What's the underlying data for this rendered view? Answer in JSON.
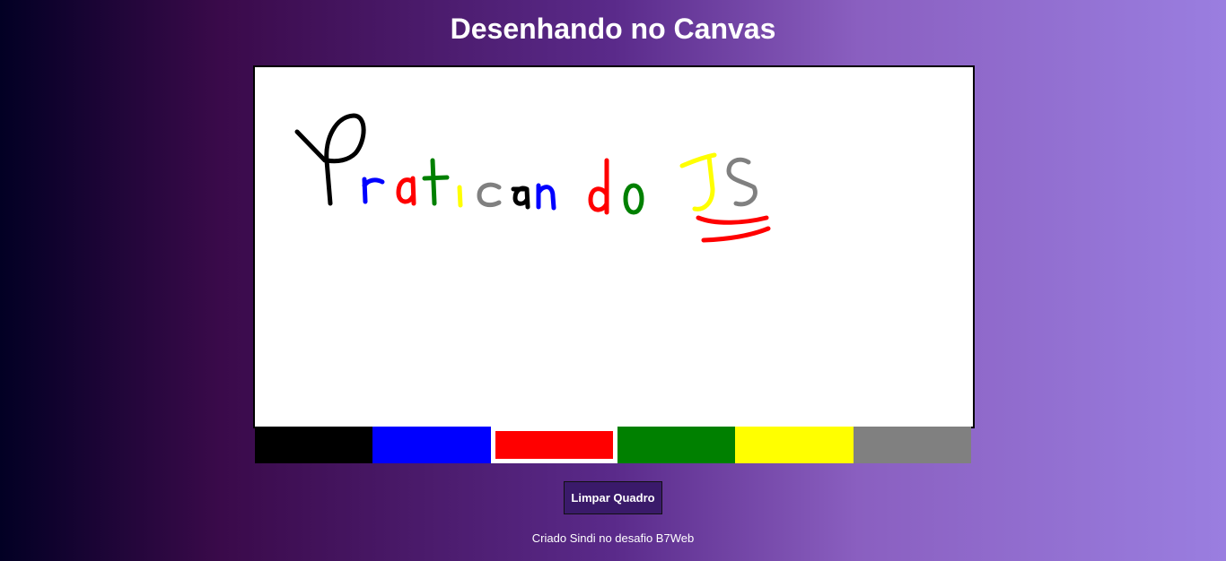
{
  "page": {
    "title": "Desenhando no Canvas"
  },
  "palette": {
    "colors": [
      "#000000",
      "#0000ff",
      "#ff0000",
      "#008000",
      "#ffff00",
      "#808080"
    ],
    "selected_index": 2
  },
  "actions": {
    "clear_label": "Limpar Quadro"
  },
  "footer": {
    "credit": "Criado Sindi no desafio B7Web"
  }
}
